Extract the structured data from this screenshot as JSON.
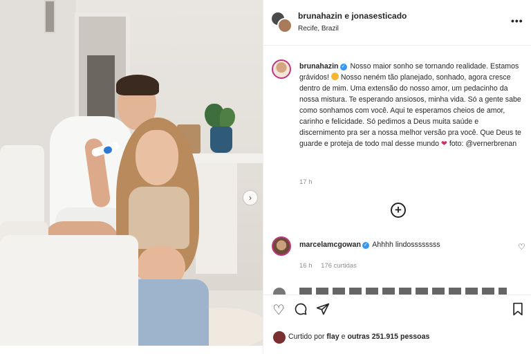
{
  "post": {
    "collaborators": "brunahazin e jonasesticado",
    "location": "Recife, Brazil",
    "more_icon": "more-horizontal-icon"
  },
  "caption": {
    "username": "brunahazin",
    "verified": true,
    "text_part1": "Nosso maior sonho se tornando realidade. Estamos grávidos!",
    "text_part2": "Nosso neném tão planejado, sonhado, agora cresce dentro de mim. Uma extensão do nosso amor, um pedacinho da nossa mistura. Te esperando ansiosos, minha vida. Só a gente sabe como sonhamos com você. Aqui te esperamos cheios de amor, carinho e felicidade. Só pedimos a Deus muita saúde e discernimento pra ser a nossa melhor versão pra você. Que Deus te guarde e proteja de todo mal desse mundo",
    "text_part3": "foto:",
    "mention": "@vernerbrenan",
    "time": "17 h"
  },
  "load_more_icon": "plus-circle-icon",
  "comments": [
    {
      "username": "marcelamcgowan",
      "verified": true,
      "text": "Ahhhh lindossssssss",
      "time": "16 h",
      "likes": "176 curtidas"
    }
  ],
  "actions": {
    "like_icon": "heart-icon",
    "comment_icon": "comment-icon",
    "share_icon": "send-icon",
    "save_icon": "bookmark-icon"
  },
  "likes_summary": {
    "prefix": "Curtido por",
    "user": "flay",
    "conjunction": "e",
    "others": "outras 251.915 pessoas"
  },
  "colors": {
    "verified": "#3897f0",
    "heart": "#e0245e",
    "story_ring": "#c13584",
    "muted_text": "#8e8e8e"
  }
}
